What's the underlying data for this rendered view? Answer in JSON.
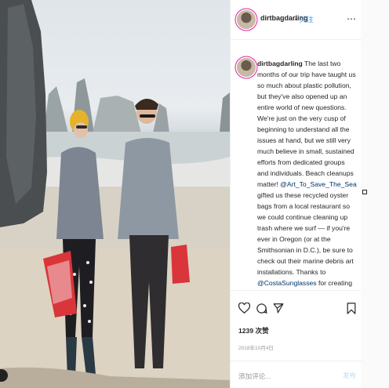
{
  "post": {
    "username": "dirtbagdarling",
    "follow_label": "关注",
    "separator": "•",
    "caption": {
      "username": "dirtbagdarling",
      "text_part1": " The last two months of our trip have taught us so much about plastic pollution, but they've also opened up an entire world of new questions. We're just on the very cusp of beginning to understand all the issues at hand, but we still very much believe in small, sustained efforts from dedicated groups and individuals. Beach cleanups matter! ",
      "mention1": "@Art_To_Save_The_Sea",
      "text_part2": " gifted us these recycled oyster bags from a local restaurant so we could continue cleaning up trash where we surf — if you're ever in Oregon (or at the Smithsonian in D.C.), be sure to check out their marine debris art installations. Thanks to ",
      "mention2": "@CostaSunglasses",
      "text_part3": " for creating plant-based sunnies to help"
    },
    "likes": "1239 次赞",
    "date": "2018年10月4日",
    "comment_placeholder": "添加评论...",
    "post_label": "发布"
  },
  "icons": {
    "like": "heart-icon",
    "comment": "comment-icon",
    "share": "share-icon",
    "save": "bookmark-icon",
    "more": "more-options-icon"
  },
  "colors": {
    "link": "#3897f0",
    "mention": "#003569",
    "post_disabled": "#b2dffc",
    "muted": "#999999"
  }
}
